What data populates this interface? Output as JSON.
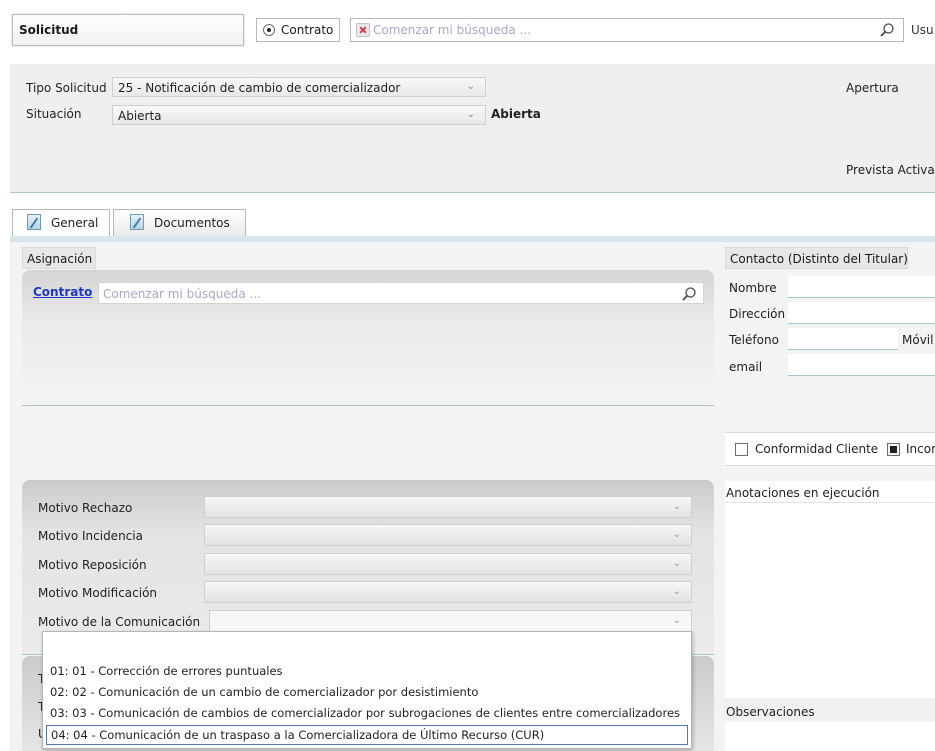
{
  "header": {
    "title": "Solicitud",
    "radio_label": "Contrato",
    "search_placeholder": "Comenzar mi búsqueda ...",
    "user_label": "Usu"
  },
  "solicitud": {
    "tipo_label": "Tipo Solicitud",
    "tipo_value": "25 - Notificación de cambio de comercializador",
    "situacion_label": "Situación",
    "situacion_value": "Abierta",
    "situacion_bold": "Abierta",
    "apertura_label": "Apertura",
    "prevista_label": "Prevista Activac"
  },
  "tabs": [
    {
      "label": "General",
      "active": true
    },
    {
      "label": "Documentos",
      "active": false
    }
  ],
  "asignacion": {
    "header": "Asignación",
    "contrato_link": "Contrato",
    "search_placeholder": "Comenzar mi búsqueda ..."
  },
  "motivos": [
    {
      "label": "Motivo Rechazo",
      "value": ""
    },
    {
      "label": "Motivo Incidencia",
      "value": ""
    },
    {
      "label": "Motivo Reposición",
      "value": ""
    },
    {
      "label": "Motivo Modificación",
      "value": ""
    },
    {
      "label": "Motivo de la Comunicación",
      "value": ""
    }
  ],
  "dropdown_options": [
    "01: 01 - Corrección de errores puntuales",
    "02: 02 - Comunicación de un cambio de comercializador por desistimiento",
    "03: 03 - Comunicación de cambios de comercializador por subrogaciones de clientes entre comercializadores",
    "04: 04 - Comunicación de un traspaso a la Comercializadora de Último Recurso (CUR)"
  ],
  "dropdown_selected_index": 3,
  "lower_letters": [
    "T",
    "T",
    "U"
  ],
  "contacto": {
    "header": "Contacto (Distinto del Titular)",
    "nombre_label": "Nombre",
    "direccion_label": "Dirección",
    "telefono_label": "Teléfono",
    "movil_label": "Móvil",
    "email_label": "email"
  },
  "conformidad": {
    "cliente_label": "Conformidad Cliente",
    "cliente_checked": false,
    "second_label": "Incor",
    "second_checked": true
  },
  "anotaciones_label": "Anotaciones en ejecución",
  "observaciones_label": "Observaciones",
  "colors": {
    "link": "#1c38c7",
    "accent_line": "#a8c6cc",
    "panel_bg": "#f3f3f3"
  }
}
